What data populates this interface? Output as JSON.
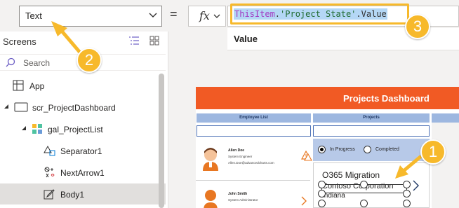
{
  "property_dropdown": {
    "value": "Text"
  },
  "equals_sign": "=",
  "formula_bar": {
    "fx_label": "fx",
    "formula_keyword": "ThisItem",
    "formula_dot1": ".",
    "formula_string": "'Project State'",
    "formula_dot2": ".",
    "formula_field": "Value",
    "result_label": "Value"
  },
  "tree": {
    "title": "Screens",
    "search_placeholder": "Search",
    "nodes": [
      {
        "label": "App"
      },
      {
        "label": "scr_ProjectDashboard"
      },
      {
        "label": "gal_ProjectList"
      },
      {
        "label": "Separator1"
      },
      {
        "label": "NextArrow1"
      },
      {
        "label": "Body1"
      }
    ]
  },
  "app_preview": {
    "header_title": "Projects  Dashboard",
    "col_employee": "Employee  List",
    "col_projects": "Projects",
    "employees": [
      {
        "name": "Allen Doe",
        "role": "System Engineer",
        "email": "Allen.Doe@advancedcharts.com"
      },
      {
        "name": "John Smith",
        "role": "System Administrator",
        "email": ""
      }
    ],
    "radio_in_progress": "In Progress",
    "radio_completed": "Completed",
    "project_title": "O365 Migration",
    "project_company": "Contoso Corporation",
    "project_location": "Indiana"
  },
  "callouts": {
    "one": "1",
    "two": "2",
    "three": "3"
  },
  "colors": {
    "header": "#f15a24",
    "callout": "#f7b92b",
    "column_head": "#9db7e0"
  }
}
